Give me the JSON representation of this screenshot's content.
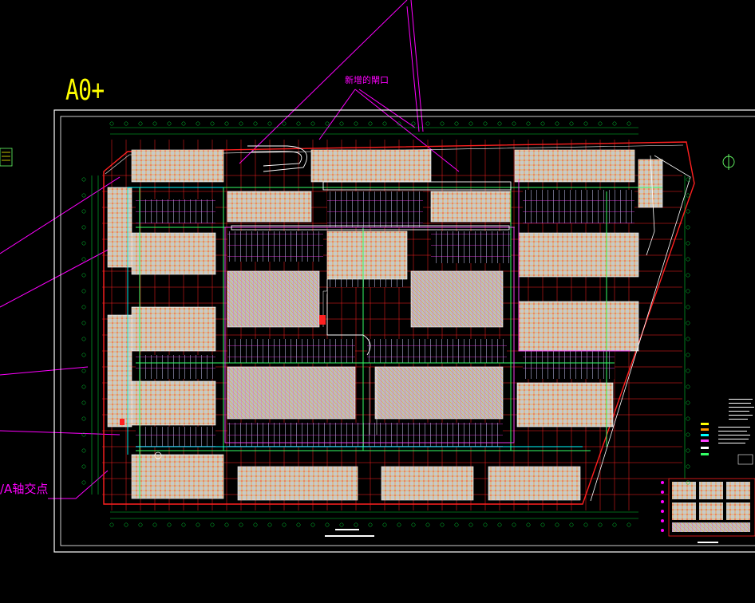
{
  "drawing": {
    "sheet_size": "A0+",
    "note_new": "新增的閘口",
    "note_axis": "/A轴交点"
  },
  "colors": {
    "background": "#000000",
    "frame": "#ffffff",
    "callout": "#ff00ff",
    "sheet_size": "#ffff00",
    "axis_red": "#ff2020",
    "dim_green": "#00cc33",
    "wall_grey": "#c8c8c8",
    "fixture_orange": "#ff9a00",
    "pipe_green": "#33ff66"
  },
  "icons": [
    "north-arrow-icon",
    "legend-swatch-icon"
  ]
}
